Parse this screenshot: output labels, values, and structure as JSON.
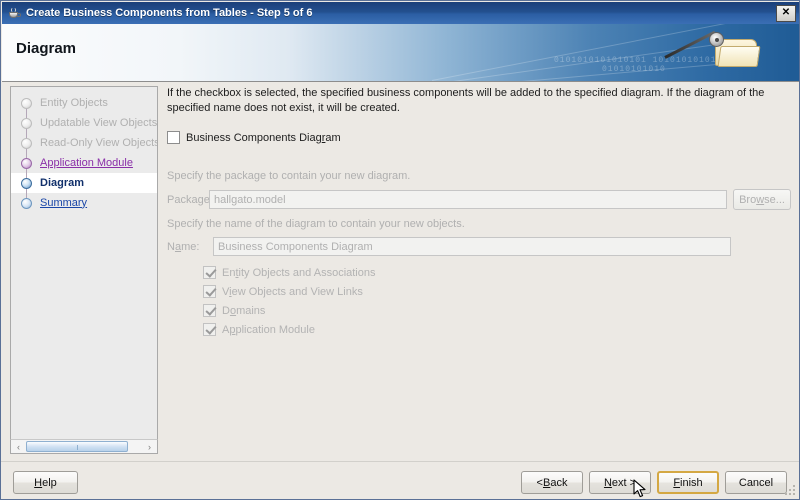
{
  "window": {
    "title": "Create Business Components from Tables - Step 5 of 6",
    "app_icon": "java-cup-icon",
    "close_label": "✕"
  },
  "banner": {
    "heading": "Diagram",
    "binary_row_1": "0101010101010101 1010101010101",
    "binary_row_2": "01010101010",
    "wizard_icon": "magic-wand-folder-icon"
  },
  "sidebar": {
    "steps": [
      {
        "label": "Entity Objects",
        "state": "done"
      },
      {
        "label": "Updatable View Objects",
        "state": "done"
      },
      {
        "label": "Read-Only View Objects",
        "state": "done"
      },
      {
        "label": "Application Module",
        "state": "visited"
      },
      {
        "label": "Diagram",
        "state": "current"
      },
      {
        "label": "Summary",
        "state": "todo"
      }
    ],
    "scroll_left": "‹",
    "scroll_right": "›"
  },
  "content": {
    "description": "If the checkbox is selected, the specified business components will be added to the specified diagram.  If the diagram of the specified name does not exist, it will be created.",
    "main_checkbox": {
      "label": "Business Components Diagram",
      "checked": false,
      "enabled": true
    },
    "package_hint": "Specify the package to contain your new diagram.",
    "package_label": "Package:",
    "package_value": "hallgato.model",
    "browse_label": "Browse...",
    "name_hint": "Specify the name of the diagram to contain your new objects.",
    "name_label": "Name:",
    "name_value": "Business Components Diagram",
    "sub_checkboxes": [
      {
        "label": "Entity Objects and Associations",
        "checked": true,
        "enabled": false
      },
      {
        "label": "View Objects and View Links",
        "checked": true,
        "enabled": false
      },
      {
        "label": "Domains",
        "checked": true,
        "enabled": false
      },
      {
        "label": "Application Module",
        "checked": true,
        "enabled": false
      }
    ]
  },
  "footer": {
    "help_label": "Help",
    "back_label": "< Back",
    "next_label": "Next >",
    "finish_label": "Finish",
    "cancel_label": "Cancel"
  },
  "colors": {
    "titlebar": "#23508f",
    "default_button_border": "#d4a843",
    "visited_link": "#8a2fa8",
    "link": "#1a46a8",
    "current_step": "#11306b"
  }
}
